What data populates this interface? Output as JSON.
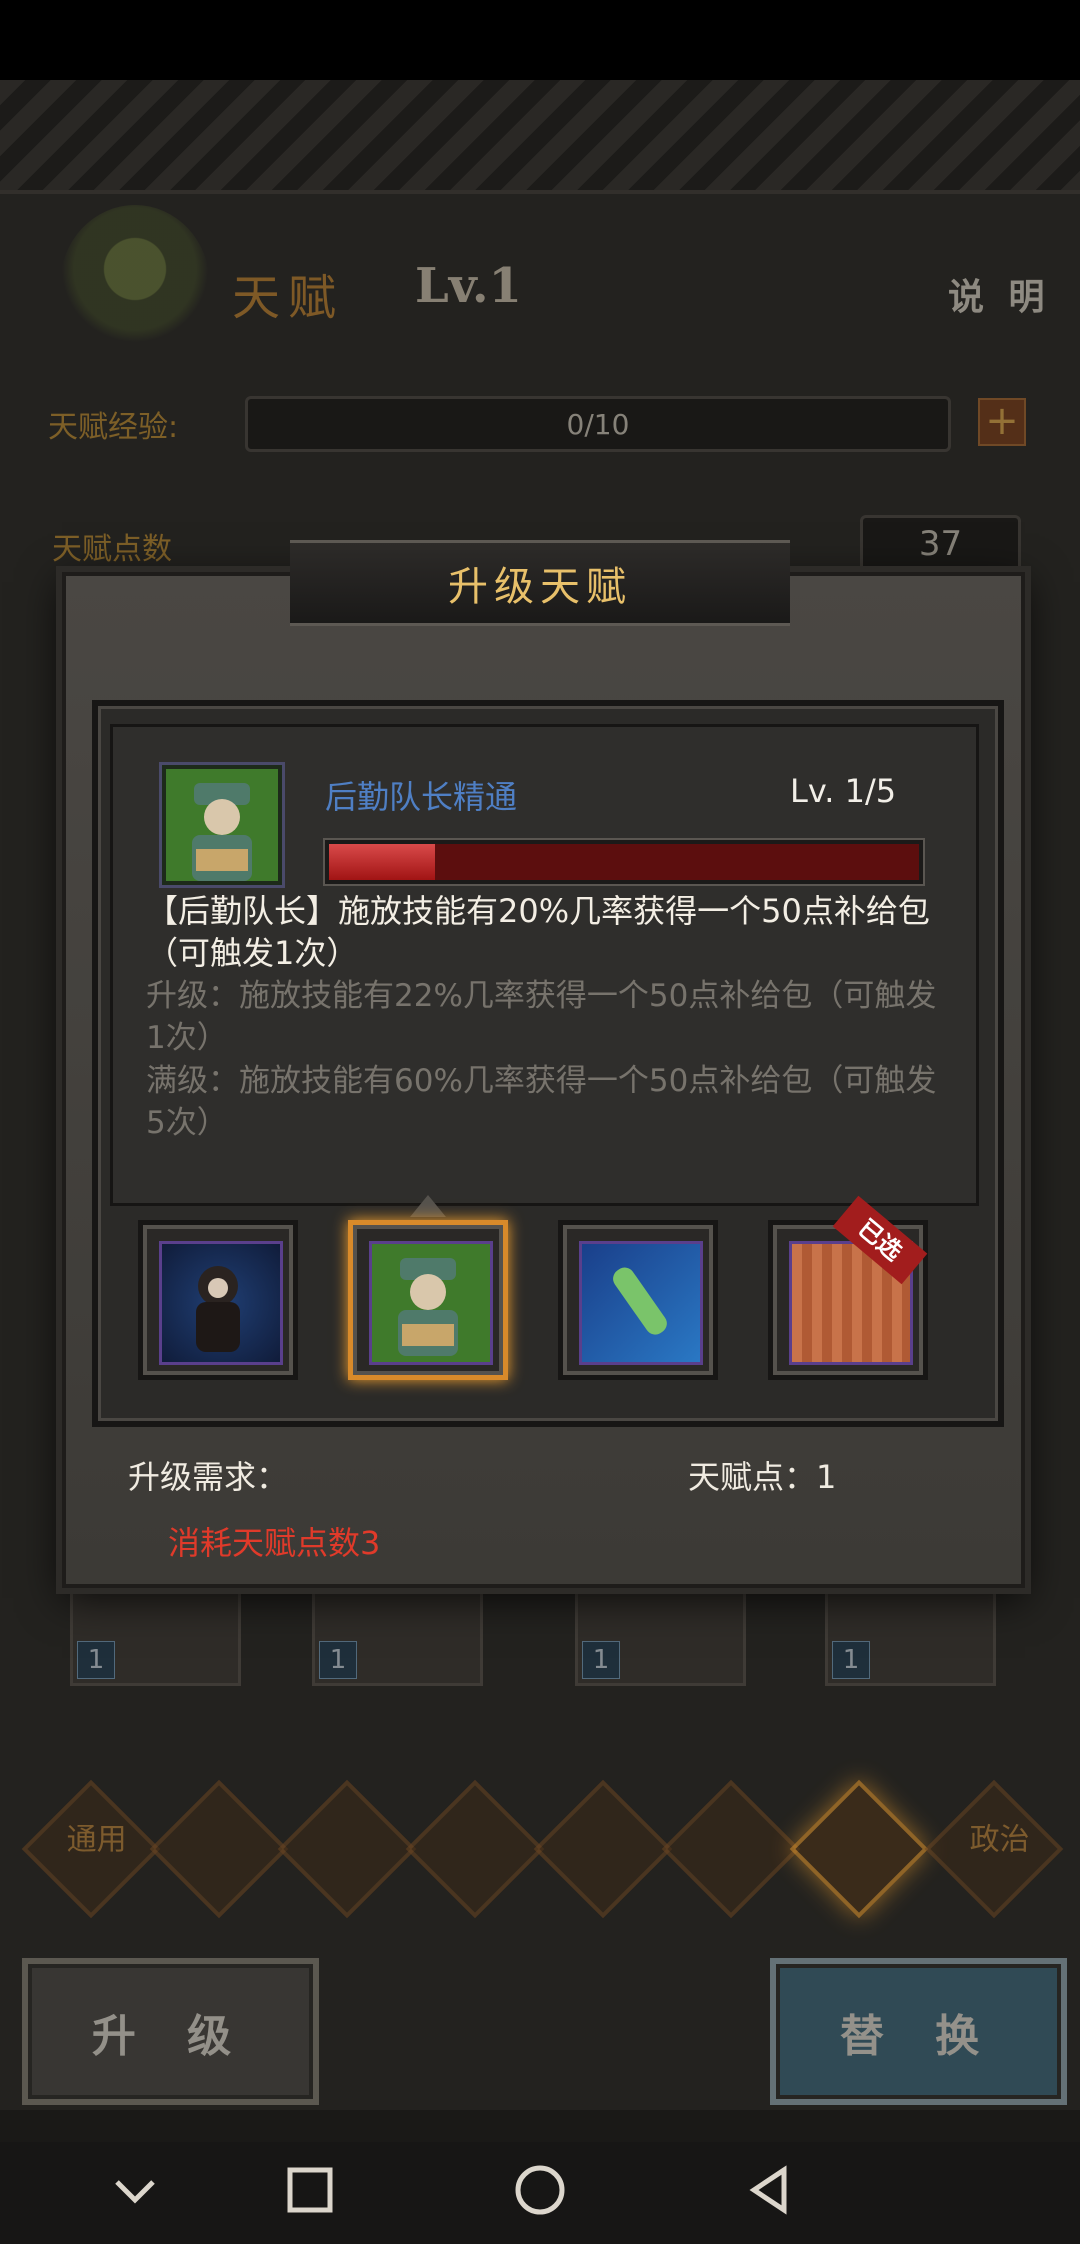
{
  "header": {
    "title": "天赋",
    "level": "Lv.1",
    "help_label": "说 明"
  },
  "stats": {
    "exp_label": "天赋经验:",
    "exp_value": "0/10",
    "points_label": "天赋点数",
    "points_value": "37"
  },
  "background_slots": [
    {
      "level": "1"
    },
    {
      "level": "1"
    },
    {
      "level": "1"
    },
    {
      "level": "1"
    }
  ],
  "categories": [
    {
      "label": "通用"
    },
    {
      "label": ""
    },
    {
      "label": ""
    },
    {
      "label": ""
    },
    {
      "label": ""
    },
    {
      "label": ""
    },
    {
      "label": ""
    },
    {
      "label": "政治"
    }
  ],
  "buttons": {
    "upgrade": "升 级",
    "replace": "替 换"
  },
  "modal": {
    "title": "升级天赋",
    "skill_name": "后勤队长精通",
    "skill_level": "Lv. 1/5",
    "progress": 0.18,
    "desc_current": "【后勤队长】施放技能有20%几率获得一个50点补给包（可触发1次）",
    "desc_next": "升级：施放技能有22%几率获得一个50点补给包（可触发1次）",
    "desc_max": "满级：施放技能有60%几率获得一个50点补给包（可触发5次）",
    "learned_badge": "已选",
    "requirement_label": "升级需求：",
    "talent_points": "天赋点：1",
    "cost_text": "消耗天赋点数3",
    "colors": {
      "name": "#4f7fc4",
      "cost": "#e03a2a",
      "title": "#e8c06a",
      "selected": "#d88a2a"
    }
  },
  "nav": {
    "back_icon": "chevron-down-icon",
    "home_icon": "square-icon",
    "circle_icon": "circle-icon",
    "triangle_icon": "triangle-back-icon"
  }
}
